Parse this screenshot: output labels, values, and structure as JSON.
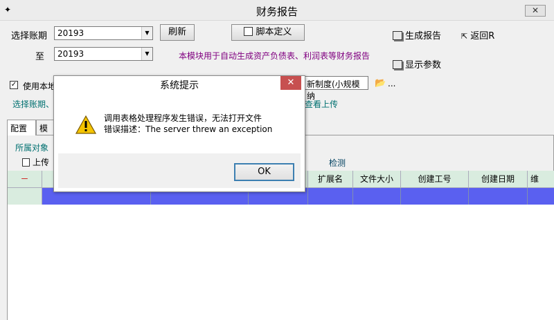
{
  "window": {
    "title": "财务报告",
    "close_label": "✕",
    "app_icon": "✦"
  },
  "toolbar": {
    "period_label": "选择账期",
    "period_value": "20193",
    "to_label": "至",
    "to_value": "20193",
    "refresh_label": "刷新",
    "script_def_label": "脚本定义",
    "generate_label": "生成报告",
    "return_label": "返回R",
    "show_params_label": "显示参数",
    "info_text": "本模块用于自动生成资产负债表、利润表等财务报告"
  },
  "options": {
    "use_local_label": "使用本地",
    "use_local_checked": "✓",
    "template_value": "新制度(小规模纳",
    "folder_icon_text": "📂",
    "ellipsis": "...",
    "select_period_text": "选择账期、",
    "view_upload_text": "查看上传"
  },
  "tabs": [
    {
      "label": "配置"
    },
    {
      "label": "模版"
    }
  ],
  "panel": {
    "owner_label": "所属对象",
    "upload_label": "上传",
    "detect_label": "检测"
  },
  "grid": {
    "columns": [
      "－",
      "",
      "",
      "",
      "扩展名",
      "文件大小",
      "创建工号",
      "创建日期",
      "维"
    ]
  },
  "dialog": {
    "title": "系统提示",
    "close_label": "✕",
    "message_line1": "调用表格处理程序发生错误，无法打开文件",
    "message_line2": "错误描述：The server threw an exception",
    "ok_label": "OK"
  }
}
